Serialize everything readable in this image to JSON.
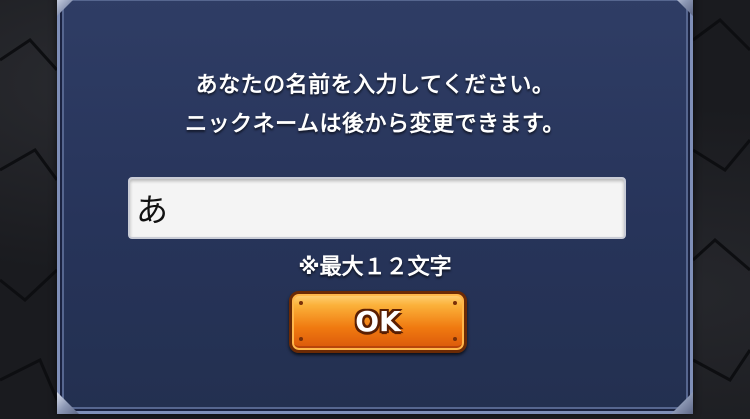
{
  "dialog": {
    "message_line1": "あなたの名前を入力してください。",
    "message_line2": "ニックネームは後から変更できます。",
    "name_input_value": "あ",
    "limit_note": "※最大１２文字",
    "ok_label": "OK"
  },
  "colors": {
    "panel": "#2b3960",
    "panel_border": "#7f8fb8",
    "button": "#f07a10",
    "button_outline": "#6b2a05",
    "text": "#ffffff"
  }
}
